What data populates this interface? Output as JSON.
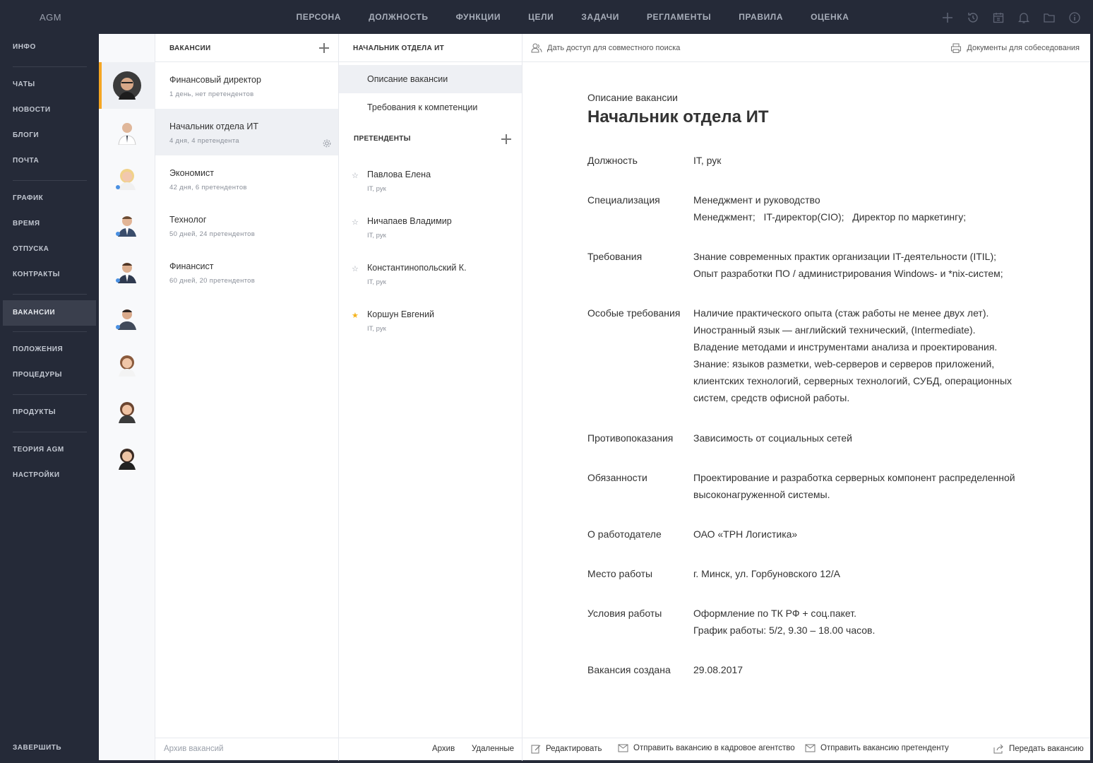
{
  "app": {
    "logo": "AGM"
  },
  "topnav": [
    "ПЕРСОНА",
    "ДОЛЖНОСТЬ",
    "ФУНКЦИИ",
    "ЦЕЛИ",
    "ЗАДАЧИ",
    "РЕГЛАМЕНТЫ",
    "ПРАВИЛА",
    "ОЦЕНКА"
  ],
  "topicons": [
    "plus-icon",
    "history-icon",
    "calendar-icon",
    "bell-icon",
    "folder-icon",
    "info-icon"
  ],
  "sidebar": {
    "items": [
      "ИНФО",
      "ЧАТЫ",
      "НОВОСТИ",
      "БЛОГИ",
      "ПОЧТА",
      "ГРАФИК",
      "ВРЕМЯ",
      "ОТПУСКА",
      "КОНТРАКТЫ",
      "ВАКАНСИИ",
      "ПОЛОЖЕНИЯ",
      "ПРОЦЕДУРЫ",
      "ПРОДУКТЫ",
      "ТЕОРИЯ AGM",
      "НАСТРОЙКИ"
    ],
    "active": "ВАКАНСИИ",
    "logout": "ЗАВЕРШИТЬ"
  },
  "vacancies": {
    "header": "ВАКАНСИИ",
    "items": [
      {
        "name": "Финансовый директор",
        "sub": "1 день, нет претендентов"
      },
      {
        "name": "Начальник отдела ИТ",
        "sub": "4 дня, 4 претендента"
      },
      {
        "name": "Экономист",
        "sub": "42 дня, 6 претендентов"
      },
      {
        "name": "Технолог",
        "sub": "50 дней, 24 претендентов"
      },
      {
        "name": "Финансист",
        "sub": "60 дней, 20 претендентов"
      }
    ],
    "archive": "Архив вакансий"
  },
  "middle": {
    "header": "НАЧАЛЬНИК ОТДЕЛА ИТ",
    "tabs": [
      "Описание вакансии",
      "Требования к компетенции"
    ],
    "candidates_header": "ПРЕТЕНДЕНТЫ",
    "candidates": [
      {
        "name": "Павлова Елена",
        "sub": "IT, рук",
        "starred": false
      },
      {
        "name": "Ничапаев Владимир",
        "sub": "IT, рук",
        "starred": false
      },
      {
        "name": "Константинопольский К.",
        "sub": "IT, рук",
        "starred": false
      },
      {
        "name": "Коршун Евгений",
        "sub": "IT, рук",
        "starred": true
      }
    ],
    "archive": "Архив",
    "deleted": "Удаленные"
  },
  "detail": {
    "share": "Дать доступ для совместного поиска",
    "docs": "Документы для собеседования",
    "subtitle": "Описание вакансии",
    "title": "Начальник отдела ИТ",
    "fields": [
      {
        "label": "Должность",
        "value": "IT, рук"
      },
      {
        "label": "Специализация",
        "value": "Менеджмент и руководство\nМенеджмент;   IT-директор(CIO);   Директор по маркетингу;"
      },
      {
        "label": "Требования",
        "value": "Знание современных практик организации IT-деятельности (ITIL);\nОпыт разработки ПО / администрирования Windows- и *nix-систем;"
      },
      {
        "label": "Особые требования",
        "value": "Наличие практического опыта (стаж работы не менее двух лет).\nИностранный язык — английский технический, (Intermediate).\nВладение методами и инструментами анализа и проектирования.\nЗнание: языков разметки, web-серверов и серверов приложений,\nклиентских технологий, серверных технологий, СУБД, операционных\nсистем, средств офисной работы."
      },
      {
        "label": "Противопоказания",
        "value": "Зависимость от социальных сетей"
      },
      {
        "label": "Обязанности",
        "value": "Проектирование и разработка серверных компонент распределенной\nвысоконагруженной системы."
      },
      {
        "label": "О работодателе",
        "value": "ОАО «ТРН Логистика»"
      },
      {
        "label": "Место работы",
        "value": "г. Минск, ул. Горбуновского 12/А"
      },
      {
        "label": "Условия работы",
        "value": "Оформление по ТК РФ + соц.пакет.\nГрафик работы: 5/2, 9.30 – 18.00 часов."
      },
      {
        "label": "Вакансия создана",
        "value": "29.08.2017"
      }
    ]
  },
  "footer": {
    "edit": "Редактировать",
    "send_agency": "Отправить вакансию в кадровое агентство",
    "send_candidate": "Отправить вакансию претенденту",
    "transfer": "Передать вакансию"
  },
  "colors": {
    "sidebar_bg": "#252a38",
    "accent": "#f5a623",
    "star": "#f5b31b",
    "dot": "#4a90e2"
  }
}
